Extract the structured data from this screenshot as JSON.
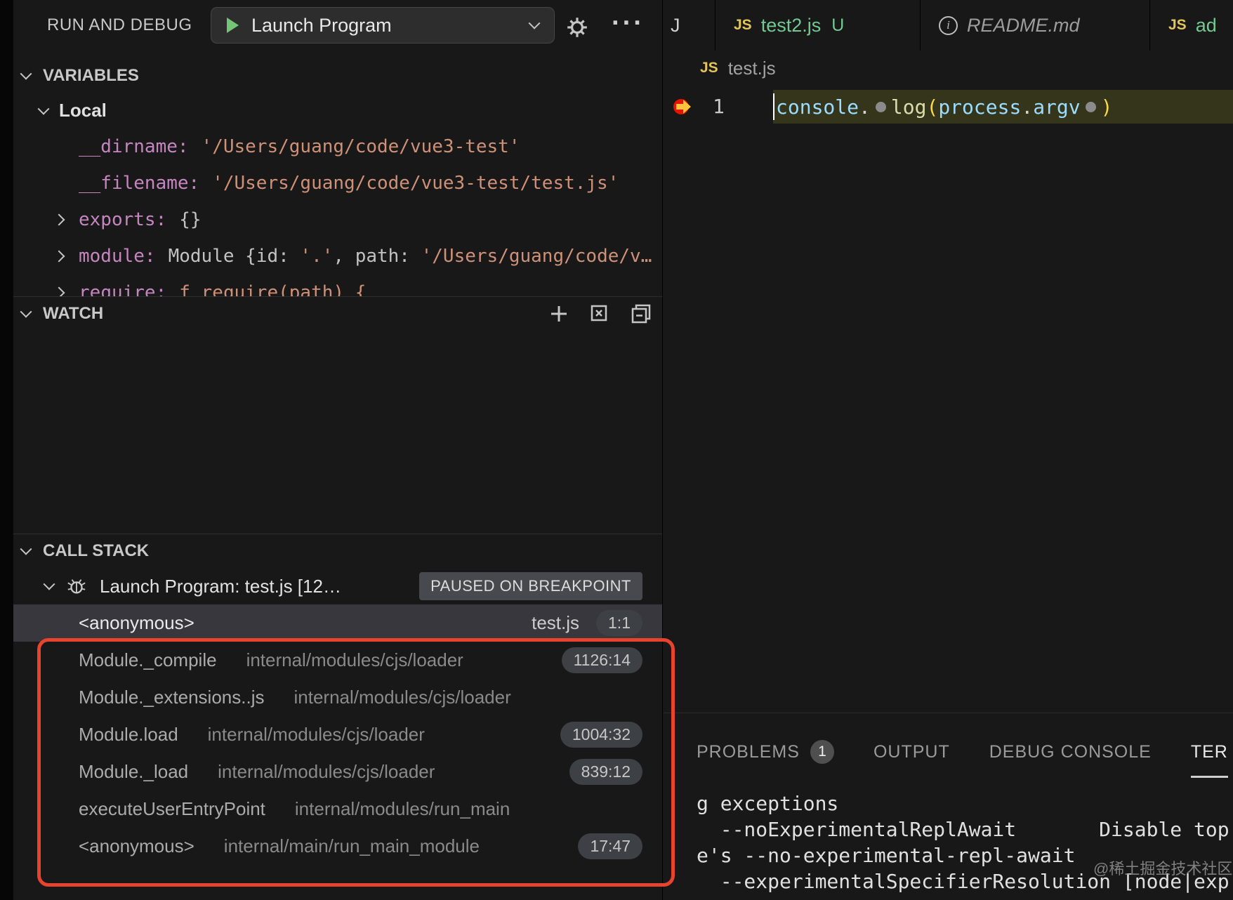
{
  "colors": {
    "annotation_red": "#e8432e",
    "git_green": "#73c991",
    "js_yellow": "#e2c45c",
    "string_orange": "#ce9178",
    "name_purple": "#c586c0",
    "ident_blue": "#9cdcfe",
    "fn_yellow": "#dcdcaa",
    "bracket_gold": "#f8d848",
    "breakpoint_red": "#e51400"
  },
  "sidebar": {
    "title": "RUN AND DEBUG",
    "launch": {
      "config_name": "Launch Program"
    },
    "variables": {
      "header": "VARIABLES",
      "scope_label": "Local",
      "items": [
        {
          "name": "__dirname:",
          "expandable": false,
          "parts": [
            {
              "text": "'/Users/guang/code/vue3-test'",
              "type": "str"
            }
          ]
        },
        {
          "name": "__filename:",
          "expandable": false,
          "parts": [
            {
              "text": "'/Users/guang/code/vue3-test/test.js'",
              "type": "str"
            }
          ]
        },
        {
          "name": "exports:",
          "expandable": true,
          "parts": [
            {
              "text": "{}",
              "type": "obj"
            }
          ]
        },
        {
          "name": "module:",
          "expandable": true,
          "parts": [
            {
              "text": "Module {id: ",
              "type": "obj"
            },
            {
              "text": "'.'",
              "type": "str"
            },
            {
              "text": ", path: ",
              "type": "obj"
            },
            {
              "text": "'/Users/guang/code/v…",
              "type": "str"
            }
          ]
        },
        {
          "name": "require:",
          "expandable": true,
          "parts": [
            {
              "text": "ƒ require(path) {",
              "type": "str"
            }
          ]
        }
      ]
    },
    "watch": {
      "header": "WATCH"
    },
    "call_stack": {
      "header": "CALL STACK",
      "session_label": "Launch Program: test.js [12…",
      "session_badge": "PAUSED ON BREAKPOINT",
      "frames": [
        {
          "name": "<anonymous>",
          "source": "test.js",
          "position": "1:1",
          "active": true
        },
        {
          "name": "Module._compile",
          "source": "internal/modules/cjs/loader",
          "position": "1126:14",
          "active": false
        },
        {
          "name": "Module._extensions..js",
          "source": "internal/modules/cjs/loader",
          "position": "",
          "active": false
        },
        {
          "name": "Module.load",
          "source": "internal/modules/cjs/loader",
          "position": "1004:32",
          "active": false
        },
        {
          "name": "Module._load",
          "source": "internal/modules/cjs/loader",
          "position": "839:12",
          "active": false
        },
        {
          "name": "executeUserEntryPoint",
          "source": "internal/modules/run_main",
          "position": "",
          "active": false
        },
        {
          "name": "<anonymous>",
          "source": "internal/main/run_main_module",
          "position": "17:47",
          "active": false
        }
      ]
    }
  },
  "editor": {
    "tabs": [
      {
        "label": "J",
        "icon": "",
        "badge": "",
        "green": false,
        "italic": false
      },
      {
        "label": "test2.js",
        "icon": "js",
        "badge": "U",
        "green": true,
        "italic": false
      },
      {
        "label": "README.md",
        "icon": "info",
        "badge": "",
        "green": false,
        "italic": true
      },
      {
        "label": "ad",
        "icon": "js",
        "badge": "",
        "green": true,
        "italic": false
      }
    ],
    "breadcrumb": {
      "file": "test.js"
    },
    "line_number": "1",
    "code_tokens": [
      {
        "text": "console",
        "type": "ident"
      },
      {
        "text": ".",
        "type": "punct"
      },
      {
        "text": "",
        "type": "bp-dot"
      },
      {
        "text": "log",
        "type": "fn"
      },
      {
        "text": "(",
        "type": "bracket"
      },
      {
        "text": "process",
        "type": "ident"
      },
      {
        "text": ".",
        "type": "punct"
      },
      {
        "text": "argv",
        "type": "ident"
      },
      {
        "text": "",
        "type": "bp-dot"
      },
      {
        "text": ")",
        "type": "bracket"
      }
    ]
  },
  "panel": {
    "tabs": [
      {
        "label": "PROBLEMS",
        "badge": "1",
        "active": false
      },
      {
        "label": "OUTPUT",
        "badge": "",
        "active": false
      },
      {
        "label": "DEBUG CONSOLE",
        "badge": "",
        "active": false
      },
      {
        "label": "TER",
        "badge": "",
        "active": true
      }
    ],
    "console_lines": [
      "g exceptions",
      "  --noExperimentalReplAwait       Disable top",
      "e's --no-experimental-repl-await",
      "  --experimentalSpecifierResolution [node|exp"
    ],
    "watermark": "@稀土掘金技术社区"
  }
}
